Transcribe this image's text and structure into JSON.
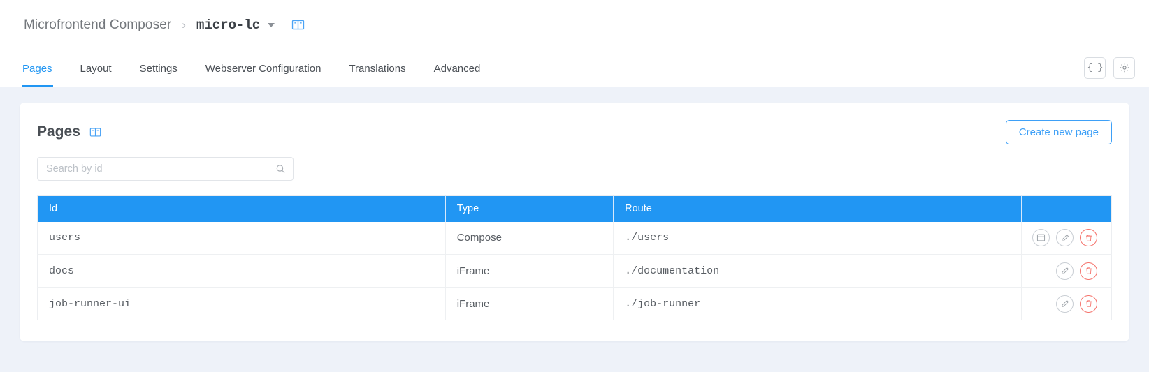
{
  "breadcrumb": {
    "root_label": "Microfrontend Composer",
    "separator": "›",
    "current_label": "micro-lc",
    "caret_icon": "chevron-down-icon",
    "book_icon": "book-icon"
  },
  "tabs": {
    "items": [
      {
        "label": "Pages",
        "active": true
      },
      {
        "label": "Layout",
        "active": false
      },
      {
        "label": "Settings",
        "active": false
      },
      {
        "label": "Webserver Configuration",
        "active": false
      },
      {
        "label": "Translations",
        "active": false
      },
      {
        "label": "Advanced",
        "active": false
      }
    ],
    "actions": [
      {
        "name": "json-editor-button",
        "icon": "curly-braces-icon",
        "glyph": "{ }"
      },
      {
        "name": "settings-button",
        "icon": "gear-icon",
        "glyph": "gear"
      }
    ]
  },
  "card": {
    "title": "Pages",
    "title_icon": "book-icon",
    "create_button_label": "Create new page"
  },
  "search": {
    "placeholder": "Search by id",
    "value": "",
    "icon": "search-icon"
  },
  "table": {
    "columns": [
      "Id",
      "Type",
      "Route",
      ""
    ],
    "rows": [
      {
        "id": "users",
        "type": "Compose",
        "route": "./users",
        "actions": [
          {
            "name": "compose-layout-button",
            "icon": "layout-icon",
            "style": "neutral"
          },
          {
            "name": "edit-button",
            "icon": "pencil-icon",
            "style": "neutral"
          },
          {
            "name": "delete-button",
            "icon": "trash-icon",
            "style": "danger"
          }
        ]
      },
      {
        "id": "docs",
        "type": "iFrame",
        "route": "./documentation",
        "actions": [
          {
            "name": "edit-button",
            "icon": "pencil-icon",
            "style": "neutral"
          },
          {
            "name": "delete-button",
            "icon": "trash-icon",
            "style": "danger"
          }
        ]
      },
      {
        "id": "job-runner-ui",
        "type": "iFrame",
        "route": "./job-runner",
        "actions": [
          {
            "name": "edit-button",
            "icon": "pencil-icon",
            "style": "neutral"
          },
          {
            "name": "delete-button",
            "icon": "trash-icon",
            "style": "danger"
          }
        ]
      }
    ]
  },
  "colors": {
    "accent": "#2196f3",
    "page_background": "#eef2f9",
    "danger": "#f5726b",
    "table_header": "#2196f3"
  }
}
